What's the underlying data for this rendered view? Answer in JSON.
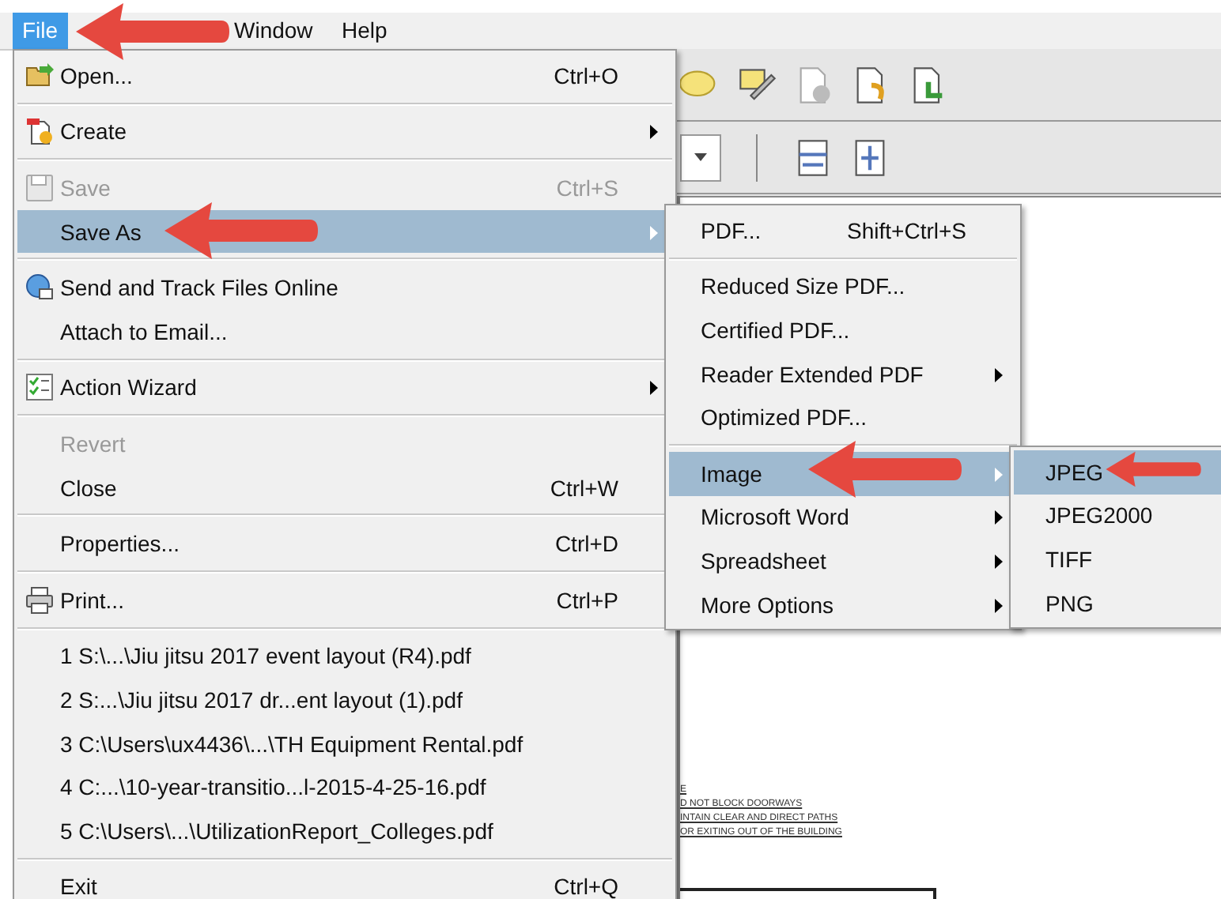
{
  "menubar": [
    {
      "label": "File",
      "selected": true
    },
    {
      "label": "Window",
      "selected": false
    },
    {
      "label": "Help",
      "selected": false
    }
  ],
  "file_menu": [
    {
      "kind": "item",
      "label": "Open...",
      "shortcut": "Ctrl+O",
      "disabled": false,
      "selected": false,
      "submenu": false
    },
    {
      "kind": "separator"
    },
    {
      "kind": "item",
      "label": "Create",
      "disabled": false,
      "selected": false,
      "submenu": true
    },
    {
      "kind": "separator"
    },
    {
      "kind": "item",
      "label": "Save",
      "shortcut": "Ctrl+S",
      "disabled": true,
      "selected": false,
      "submenu": false
    },
    {
      "kind": "item",
      "label": "Save As",
      "disabled": false,
      "selected": true,
      "submenu": true
    },
    {
      "kind": "separator"
    },
    {
      "kind": "item",
      "label": "Send and Track Files Online",
      "disabled": false,
      "selected": false,
      "submenu": false
    },
    {
      "kind": "item",
      "label": "Attach to Email...",
      "disabled": false,
      "selected": false,
      "submenu": false
    },
    {
      "kind": "separator"
    },
    {
      "kind": "item",
      "label": "Action Wizard",
      "disabled": false,
      "selected": false,
      "submenu": true
    },
    {
      "kind": "separator"
    },
    {
      "kind": "item",
      "label": "Revert",
      "disabled": true,
      "selected": false,
      "submenu": false
    },
    {
      "kind": "item",
      "label": "Close",
      "shortcut": "Ctrl+W",
      "disabled": false,
      "selected": false,
      "submenu": false
    },
    {
      "kind": "separator"
    },
    {
      "kind": "item",
      "label": "Properties...",
      "shortcut": "Ctrl+D",
      "disabled": false,
      "selected": false,
      "submenu": false
    },
    {
      "kind": "separator"
    },
    {
      "kind": "item",
      "label": "Print...",
      "shortcut": "Ctrl+P",
      "disabled": false,
      "selected": false,
      "submenu": false
    },
    {
      "kind": "separator"
    },
    {
      "kind": "item",
      "label": "1 S:\\...\\Jiu jitsu 2017 event layout (R4).pdf",
      "disabled": false,
      "selected": false,
      "submenu": false
    },
    {
      "kind": "item",
      "label": "2 S:...\\Jiu jitsu 2017 dr...ent layout (1).pdf",
      "disabled": false,
      "selected": false,
      "submenu": false
    },
    {
      "kind": "item",
      "label": "3 C:\\Users\\ux4436\\...\\TH Equipment Rental.pdf",
      "disabled": false,
      "selected": false,
      "submenu": false
    },
    {
      "kind": "item",
      "label": "4 C:...\\10-year-transitio...l-2015-4-25-16.pdf",
      "disabled": false,
      "selected": false,
      "submenu": false
    },
    {
      "kind": "item",
      "label": "5 C:\\Users\\...\\UtilizationReport_Colleges.pdf",
      "disabled": false,
      "selected": false,
      "submenu": false
    },
    {
      "kind": "separator"
    },
    {
      "kind": "item",
      "label": "Exit",
      "shortcut": "Ctrl+Q",
      "disabled": false,
      "selected": false,
      "submenu": false
    }
  ],
  "save_as_menu": [
    {
      "kind": "item",
      "label": "PDF...",
      "shortcut": "Shift+Ctrl+S",
      "selected": false,
      "submenu": false
    },
    {
      "kind": "separator"
    },
    {
      "kind": "item",
      "label": "Reduced Size PDF...",
      "selected": false,
      "submenu": false
    },
    {
      "kind": "item",
      "label": "Certified PDF...",
      "selected": false,
      "submenu": false
    },
    {
      "kind": "item",
      "label": "Reader Extended PDF",
      "selected": false,
      "submenu": true
    },
    {
      "kind": "item",
      "label": "Optimized PDF...",
      "selected": false,
      "submenu": false
    },
    {
      "kind": "separator"
    },
    {
      "kind": "item",
      "label": "Image",
      "selected": true,
      "submenu": true
    },
    {
      "kind": "item",
      "label": "Microsoft Word",
      "selected": false,
      "submenu": true
    },
    {
      "kind": "item",
      "label": "Spreadsheet",
      "selected": false,
      "submenu": true
    },
    {
      "kind": "item",
      "label": "More Options",
      "selected": false,
      "submenu": true
    }
  ],
  "image_menu": [
    {
      "label": "JPEG",
      "selected": true
    },
    {
      "label": "JPEG2000",
      "selected": false
    },
    {
      "label": "TIFF",
      "selected": false
    },
    {
      "label": "PNG",
      "selected": false
    }
  ],
  "document_text": [
    "E",
    "D NOT BLOCK DOORWAYS",
    "INTAIN CLEAR AND DIRECT PATHS",
    "OR EXITING OUT OF THE BUILDING"
  ]
}
